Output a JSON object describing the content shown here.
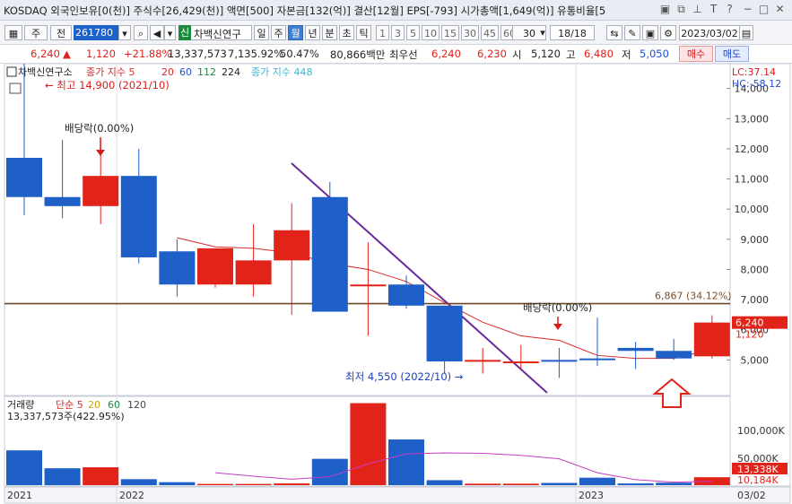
{
  "info_bar": {
    "text": "KOSDAQ 외국인보유[0(천)] 주식수[26,429(천)] 액면[500] 자본금[132(억)] 결산[12월] EPS[-793] 시가총액[1,649(억)] 유통비율[5"
  },
  "toolbar": {
    "market": "주",
    "range": "전",
    "code": "261780",
    "badge": "신",
    "stock_name": "차백신연구",
    "periods": [
      "일",
      "주",
      "월",
      "년",
      "분",
      "초",
      "틱"
    ],
    "selected_period": "월",
    "intervals": [
      "1",
      "3",
      "5",
      "10",
      "15",
      "30",
      "45",
      "60"
    ],
    "count": "30",
    "page": "18/18",
    "date": "2023/03/02"
  },
  "price_row": {
    "price": "6,240",
    "change_arrow": "▲",
    "change": "1,120",
    "change_pct": "+21.88%",
    "volume": "13,337,573",
    "volume_pct": "7,135.92%",
    "ratio": "50.47%",
    "amount": "80,866백만",
    "pref_label": "최우선",
    "ask": "6,240",
    "bid": "6,230",
    "open_label": "시",
    "open": "5,120",
    "high_label": "고",
    "high": "6,480",
    "low_label": "저",
    "low": "5,050",
    "buy_label": "매수",
    "sell_label": "매도"
  },
  "legend": {
    "name": "차백신연구소",
    "ma_title": "종가 지수 5",
    "ma_values": [
      "20",
      "60",
      "112",
      "224"
    ],
    "ma448": "종가 지수 448"
  },
  "annotations": {
    "high_label": "최고 14,900 (2021/10)",
    "low_label": "최저 4,550 (2022/10)",
    "dividend1": "배당락(0.00%)",
    "dividend2": "배당락(0.00%)",
    "hline_label": "6,867 (34.12%)",
    "lc_label": "LC:37.14",
    "hc_label": "HC:-58.12",
    "current_price_tag": "6,240",
    "prev_close_tag": "1,120"
  },
  "colors": {
    "up": "#e2231a",
    "down": "#1e5fc8",
    "ma": "#d62a2a",
    "trend": "#6a2a9a",
    "hline": "#6b4a2a"
  },
  "chart_data": [
    {
      "type": "candlestick",
      "title": "차백신연구소",
      "x": [
        "2021-09",
        "2021-10",
        "2021-11",
        "2021-12",
        "2022-01",
        "2022-02",
        "2022-03",
        "2022-04",
        "2022-05",
        "2022-06",
        "2022-07",
        "2022-08",
        "2022-09",
        "2022-10",
        "2022-11",
        "2022-12",
        "2023-01",
        "2023-02",
        "2023-03"
      ],
      "open": [
        11700,
        10400,
        10100,
        11100,
        8600,
        7500,
        7500,
        8300,
        10400,
        7500,
        7500,
        6800,
        4950,
        4950,
        5000,
        5050,
        5400,
        5300,
        5120
      ],
      "high": [
        14900,
        12300,
        12300,
        12000,
        9000,
        8500,
        9500,
        10200,
        10900,
        8900,
        7800,
        6800,
        5400,
        5500,
        5400,
        6400,
        5600,
        5700,
        6480
      ],
      "low": [
        9800,
        9700,
        9500,
        8200,
        7100,
        7400,
        7100,
        6500,
        6600,
        5800,
        6700,
        4550,
        4550,
        4700,
        4400,
        4800,
        4700,
        5000,
        5050
      ],
      "close": [
        10400,
        10100,
        11100,
        8400,
        7500,
        8700,
        8300,
        9300,
        6600,
        7500,
        6800,
        4950,
        5000,
        4950,
        4950,
        5000,
        5300,
        5050,
        6240
      ],
      "ma5": [
        null,
        null,
        null,
        null,
        9050,
        8750,
        8700,
        8550,
        8200,
        8000,
        7600,
        6900,
        6250,
        5800,
        5650,
        5150,
        5050,
        5050,
        5350
      ],
      "ylim": [
        4000,
        15000
      ],
      "yticks": [
        "5,000",
        "6,000",
        "7,000",
        "8,000",
        "9,000",
        "10,000",
        "11,000",
        "12,000",
        "13,000",
        "14,000"
      ],
      "xlabels": [
        "2021",
        "2022",
        "2023",
        "03/02"
      ]
    },
    {
      "type": "bar",
      "title": "거래량",
      "legend": [
        "단순 5",
        "20",
        "60",
        "120"
      ],
      "summary": "13,337,573주(422.95%)",
      "values": [
        7000000,
        3400000,
        3600000,
        1200000,
        600000,
        250000,
        250000,
        350000,
        5300000,
        16500000,
        9200000,
        1000000,
        300000,
        300000,
        450000,
        1500000,
        350000,
        500000,
        1600000
      ],
      "ma": [
        null,
        null,
        null,
        null,
        null,
        2500000,
        1800000,
        1200000,
        1700000,
        4300000,
        6300000,
        6500000,
        6400000,
        6000000,
        5300000,
        2500000,
        1100000,
        600000,
        800000
      ],
      "yticks": [
        "100,000K",
        "50,000K"
      ],
      "tags": [
        "13,338K",
        "10,184K"
      ]
    }
  ]
}
